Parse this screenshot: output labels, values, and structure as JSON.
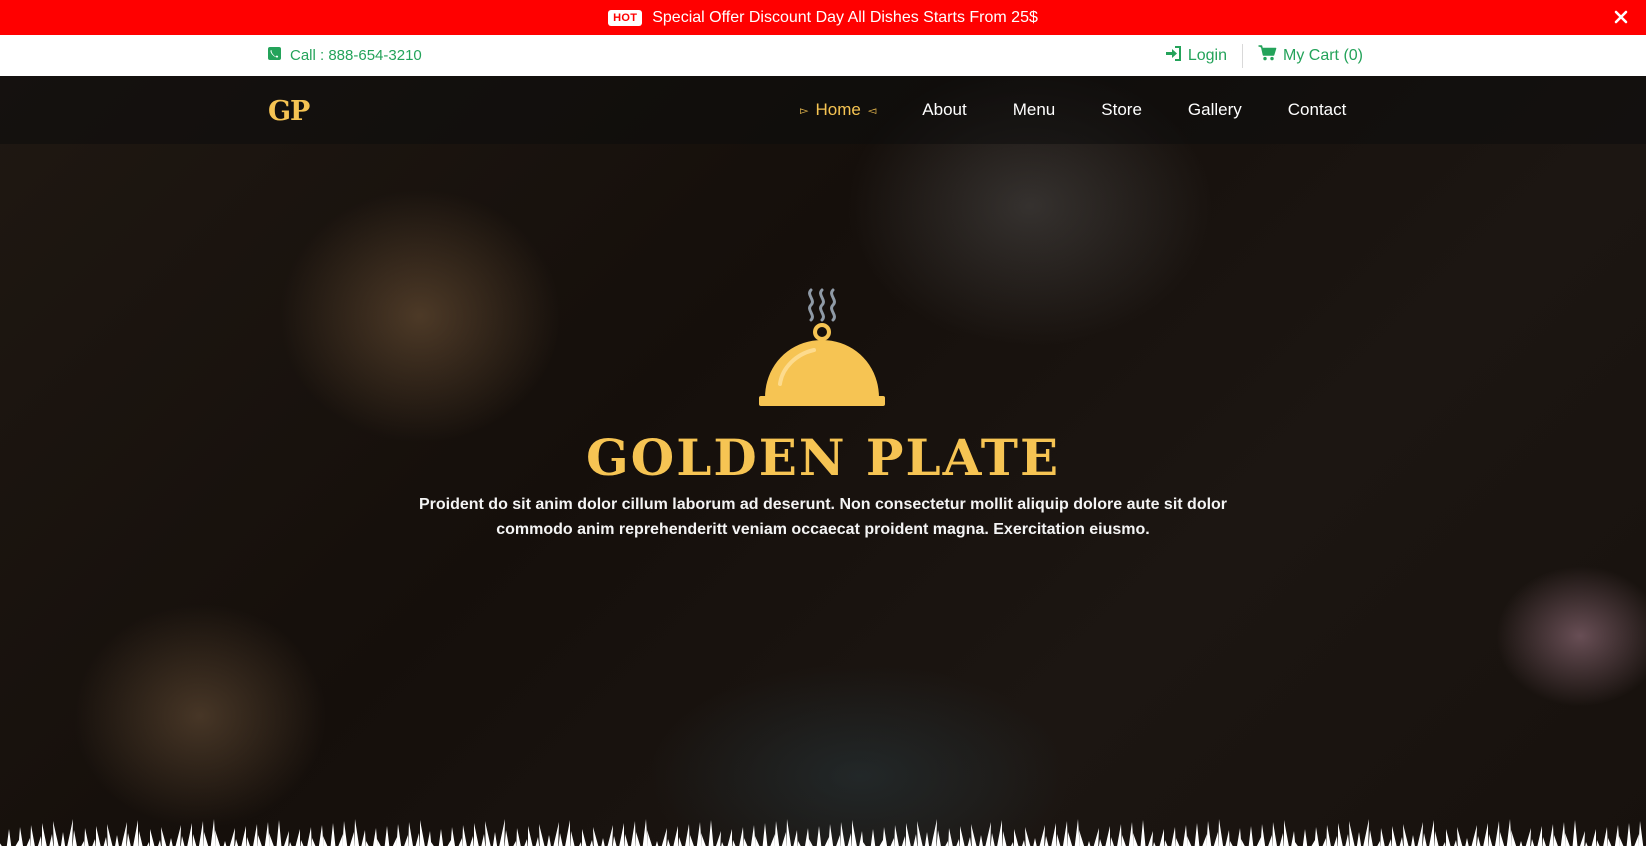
{
  "promo": {
    "badge": "HOT",
    "text": "Special Offer Discount Day All Dishes Starts From 25$"
  },
  "topbar": {
    "call": "Call : 888-654-3210",
    "login": "Login",
    "cart": "My Cart (0)"
  },
  "nav": {
    "logo": "GP",
    "items": [
      "Home",
      "About",
      "Menu",
      "Store",
      "Gallery",
      "Contact"
    ],
    "active": "Home"
  },
  "hero": {
    "title": "GOLDEN PLATE",
    "text": "Proident do sit anim dolor cillum laborum ad deserunt. Non consectetur mollit aliquip dolore aute sit dolor commodo anim reprehenderitt veniam occaecat proident magna. Exercitation eiusmo."
  },
  "colors": {
    "promo_bg": "#ff0000",
    "accent_gold": "#f6c453",
    "contact_green": "#24a35a"
  },
  "icons": [
    "phone-icon",
    "login-icon",
    "cart-icon",
    "close-icon",
    "cloche-icon",
    "arrow-right-icon",
    "arrow-left-icon"
  ]
}
